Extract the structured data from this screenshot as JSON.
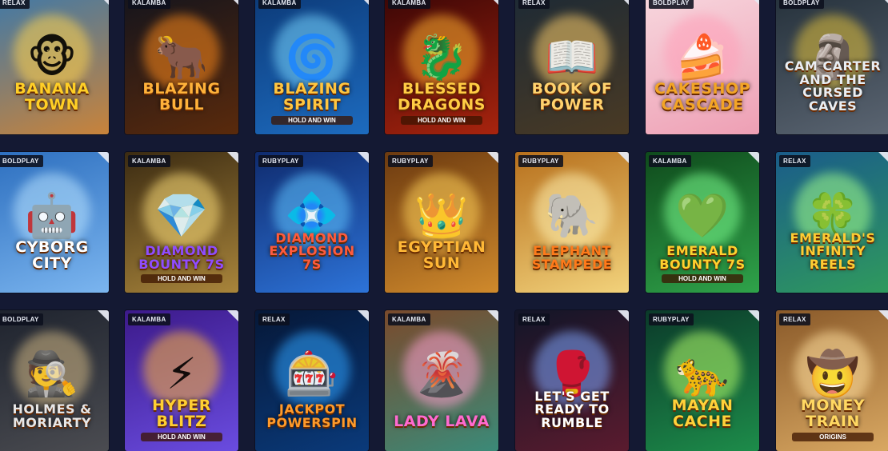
{
  "games": [
    {
      "provider": "RELAX",
      "title": "Banana Town",
      "subtitle": "",
      "bg": "#3f79a8",
      "bg2": "#c9833a",
      "glow": "#ffd34d",
      "icon": "🐵",
      "accent": "#ffcf26"
    },
    {
      "provider": "KALAMBA",
      "title": "Blazing Bull",
      "subtitle": "",
      "bg": "#14141c",
      "bg2": "#5a2a0c",
      "glow": "#ff8a1a",
      "icon": "🐂",
      "accent": "#ffb23a"
    },
    {
      "provider": "KALAMBA",
      "title": "Blazing Spirit",
      "subtitle": "Hold and Win",
      "bg": "#0c3a78",
      "bg2": "#1d6bbf",
      "glow": "#79d7ff",
      "icon": "🌀",
      "accent": "#ffc640"
    },
    {
      "provider": "KALAMBA",
      "title": "Blessed Dragons",
      "subtitle": "Hold and Win",
      "bg": "#3a0606",
      "bg2": "#a8240e",
      "glow": "#ffb02e",
      "icon": "🐉",
      "accent": "#ffcc44"
    },
    {
      "provider": "RELAX",
      "title": "Book of Power",
      "subtitle": "",
      "bg": "#1d2a35",
      "bg2": "#4a3a24",
      "glow": "#ffcf6a",
      "icon": "📖",
      "accent": "#ffd36e"
    },
    {
      "provider": "BOLDPLAY",
      "title": "Cakeshop Cascade",
      "subtitle": "",
      "bg": "#f7d7de",
      "bg2": "#ee9fb4",
      "glow": "#ff9fb8",
      "icon": "🍰",
      "accent": "#f3a526"
    },
    {
      "provider": "BOLDPLAY",
      "title": "Cam Carter and the Cursed Caves",
      "subtitle": "",
      "bg": "#25313b",
      "bg2": "#5b6572",
      "glow": "#e3c13a",
      "icon": "🗿",
      "accent": "#e9eef3"
    },
    {
      "provider": "BOLDPLAY",
      "title": "Cyborg City",
      "subtitle": "",
      "bg": "#2d6fbf",
      "bg2": "#7bb5ef",
      "glow": "#b9e3ff",
      "icon": "🤖",
      "accent": "#ffffff"
    },
    {
      "provider": "KALAMBA",
      "title": "Diamond Bounty 7s",
      "subtitle": "Hold and Win",
      "bg": "#3b2b12",
      "bg2": "#a9853b",
      "glow": "#ffe07a",
      "icon": "💎",
      "accent": "#8e4dff"
    },
    {
      "provider": "RUBYPLAY",
      "title": "Diamond Explosion 7s",
      "subtitle": "",
      "bg": "#0f2b6e",
      "bg2": "#2d73d8",
      "glow": "#5fc4ff",
      "icon": "💠",
      "accent": "#ff5b3d"
    },
    {
      "provider": "RUBYPLAY",
      "title": "Egyptian Sun",
      "subtitle": "",
      "bg": "#6c3a10",
      "bg2": "#d08a2c",
      "glow": "#ffd25a",
      "icon": "👑",
      "accent": "#ffb836"
    },
    {
      "provider": "RUBYPLAY",
      "title": "Elephant Stampede",
      "subtitle": "",
      "bg": "#b7701d",
      "bg2": "#f2d27b",
      "glow": "#fff2b2",
      "icon": "🐘",
      "accent": "#ff7a1a"
    },
    {
      "provider": "KALAMBA",
      "title": "Emerald Bounty 7s",
      "subtitle": "Hold and Win",
      "bg": "#0f4a1c",
      "bg2": "#2fa34a",
      "glow": "#7dff8f",
      "icon": "💚",
      "accent": "#ffd12e"
    },
    {
      "provider": "RELAX",
      "title": "Emerald's Infinity Reels",
      "subtitle": "",
      "bg": "#1a5c8a",
      "bg2": "#2f9a5d",
      "glow": "#a3ff8b",
      "icon": "🍀",
      "accent": "#ffcc33"
    },
    {
      "provider": "BOLDPLAY",
      "title": "Holmes & Moriarty",
      "subtitle": "",
      "bg": "#1e232e",
      "bg2": "#4b4c51",
      "glow": "#d3b985",
      "icon": "🕵",
      "accent": "#e7e7e7"
    },
    {
      "provider": "KALAMBA",
      "title": "Hyper Blitz",
      "subtitle": "Hold and Win",
      "bg": "#3c1a8a",
      "bg2": "#6a4ce0",
      "glow": "#ffb63a",
      "icon": "⚡",
      "accent": "#ffd032"
    },
    {
      "provider": "RELAX",
      "title": "Jackpot Powerspin",
      "subtitle": "",
      "bg": "#061838",
      "bg2": "#0a3a7a",
      "glow": "#2fa3ff",
      "icon": "🎰",
      "accent": "#ff9a2a"
    },
    {
      "provider": "KALAMBA",
      "title": "Lady Lava",
      "subtitle": "",
      "bg": "#7a4a2c",
      "bg2": "#3b8a78",
      "glow": "#ff9fd0",
      "icon": "🌋",
      "accent": "#ff6ad0"
    },
    {
      "provider": "RELAX",
      "title": "Let's Get Ready to Rumble",
      "subtitle": "",
      "bg": "#121528",
      "bg2": "#5a1b2e",
      "glow": "#7fa7ff",
      "icon": "🥊",
      "accent": "#ffffff"
    },
    {
      "provider": "RUBYPLAY",
      "title": "Mayan Cache",
      "subtitle": "",
      "bg": "#0b3a2a",
      "bg2": "#1d8c4a",
      "glow": "#b6ff6a",
      "icon": "🐆",
      "accent": "#ffd23a"
    },
    {
      "provider": "RELAX",
      "title": "Money Train",
      "subtitle": "Origins",
      "bg": "#8a5a2a",
      "bg2": "#d9a862",
      "glow": "#ffe0a0",
      "icon": "🤠",
      "accent": "#ffd862"
    }
  ]
}
